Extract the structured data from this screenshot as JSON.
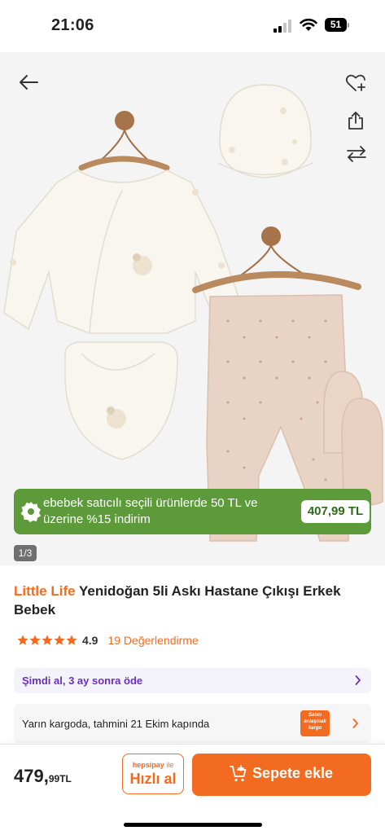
{
  "status": {
    "time": "21:06",
    "battery": "51"
  },
  "promo": {
    "text": "ebebek satıcılı seçili ürünlerde 50 TL ve üzerine %15 indirim",
    "price": "407,99 TL"
  },
  "gallery": {
    "page": "1/3"
  },
  "product": {
    "brand": "Little Life",
    "name": "Yenidoğan 5li Askı Hastane Çıkışı Erkek Bebek",
    "rating": "4.9",
    "reviews": "19 Değerlendirme",
    "stars": 5
  },
  "bnpl": {
    "text": "Şimdi al, 3 ay sonra öde"
  },
  "shipping": {
    "text": "Yarın kargoda, tahmini 21 Ekim kapında",
    "badge_line1": "Satıcı",
    "badge_line2": "anlaşmalı",
    "badge_line3": "kargo"
  },
  "bottom": {
    "price_main": "479,",
    "price_dec": "99TL",
    "quick_brand": "hepsipay",
    "quick_suffix": " ile",
    "quick_label": "Hızlı al",
    "cart_label": "Sepete ekle"
  },
  "colors": {
    "accent": "#f26b21",
    "promo_green": "#5d9b3a",
    "bnpl_purple": "#6b2fbf"
  },
  "icons": [
    "back-arrow-icon",
    "heart-plus-icon",
    "share-icon",
    "compare-arrows-icon",
    "percent-badge-icon",
    "star-icon",
    "chevron-right-icon",
    "cart-plus-icon"
  ]
}
